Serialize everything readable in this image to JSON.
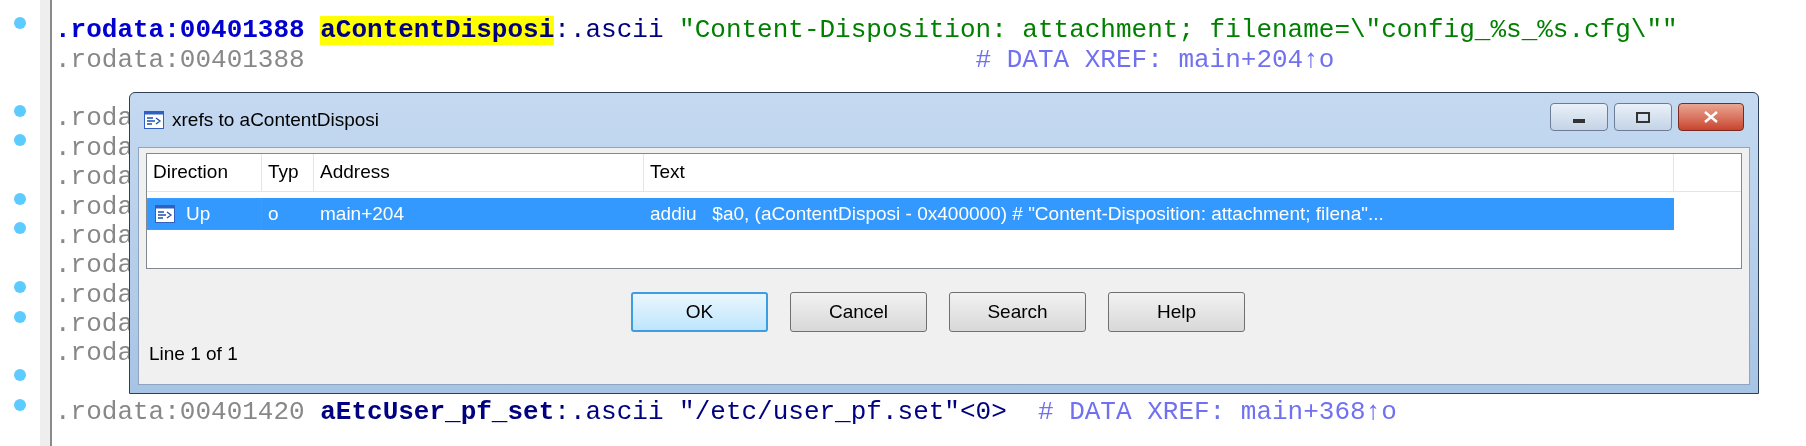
{
  "code_lines_top": [
    {
      "address": ".rodata:00401388",
      "current": true,
      "breakpoint": true,
      "label": "aContentDisposi",
      "highlighted": true,
      "directive": ":.ascii",
      "operand": "\"Content-Disposition: attachment; filename=\\\"config_%s_%s.cfg\\\"\"",
      "color": "#008000"
    },
    {
      "address": ".rodata:00401388",
      "current": false,
      "breakpoint": false,
      "comment": "# DATA XREF: main+204↑o"
    }
  ],
  "code_lines_bottom": [
    {
      "address": ".roda",
      "current": false,
      "breakpoint": true
    },
    {
      "address": ".roda",
      "current": false,
      "breakpoint": true
    },
    {
      "address": ".roda",
      "current": false,
      "breakpoint": false
    },
    {
      "address": ".roda",
      "current": false,
      "breakpoint": true
    },
    {
      "address": ".roda",
      "current": false,
      "breakpoint": true
    },
    {
      "address": ".roda",
      "current": false,
      "breakpoint": false
    },
    {
      "address": ".roda",
      "current": false,
      "breakpoint": true
    },
    {
      "address": ".roda",
      "current": false,
      "breakpoint": true
    },
    {
      "address": ".roda",
      "current": false,
      "breakpoint": false
    },
    {
      "breakpoint": true
    },
    {
      "address": ".rodata:00401420",
      "current": false,
      "breakpoint": true,
      "label": "aEtcUser_pf_set",
      "highlighted": false,
      "directive": ":.ascii",
      "operand": "\"/etc/user_pf.set\"<0>",
      "color": "#000080",
      "comment": "# DATA XREF: main+368↑o"
    }
  ],
  "dialog": {
    "title": "xrefs to aContentDisposi",
    "columns": [
      {
        "label": "Direction"
      },
      {
        "label": "Typ"
      },
      {
        "label": "Address"
      },
      {
        "label": "Text"
      }
    ],
    "rows": [
      {
        "direction": "Up",
        "type": "o",
        "address": "main+204",
        "text": "addiu   $a0, (aContentDisposi - 0x400000) # \"Content-Disposition: attachment; filena\"...",
        "selected": true
      }
    ],
    "buttons": [
      {
        "label": "OK",
        "focused": true
      },
      {
        "label": "Cancel",
        "focused": false
      },
      {
        "label": "Search",
        "focused": false
      },
      {
        "label": "Help",
        "focused": false
      }
    ],
    "status": "Line 1 of 1"
  }
}
